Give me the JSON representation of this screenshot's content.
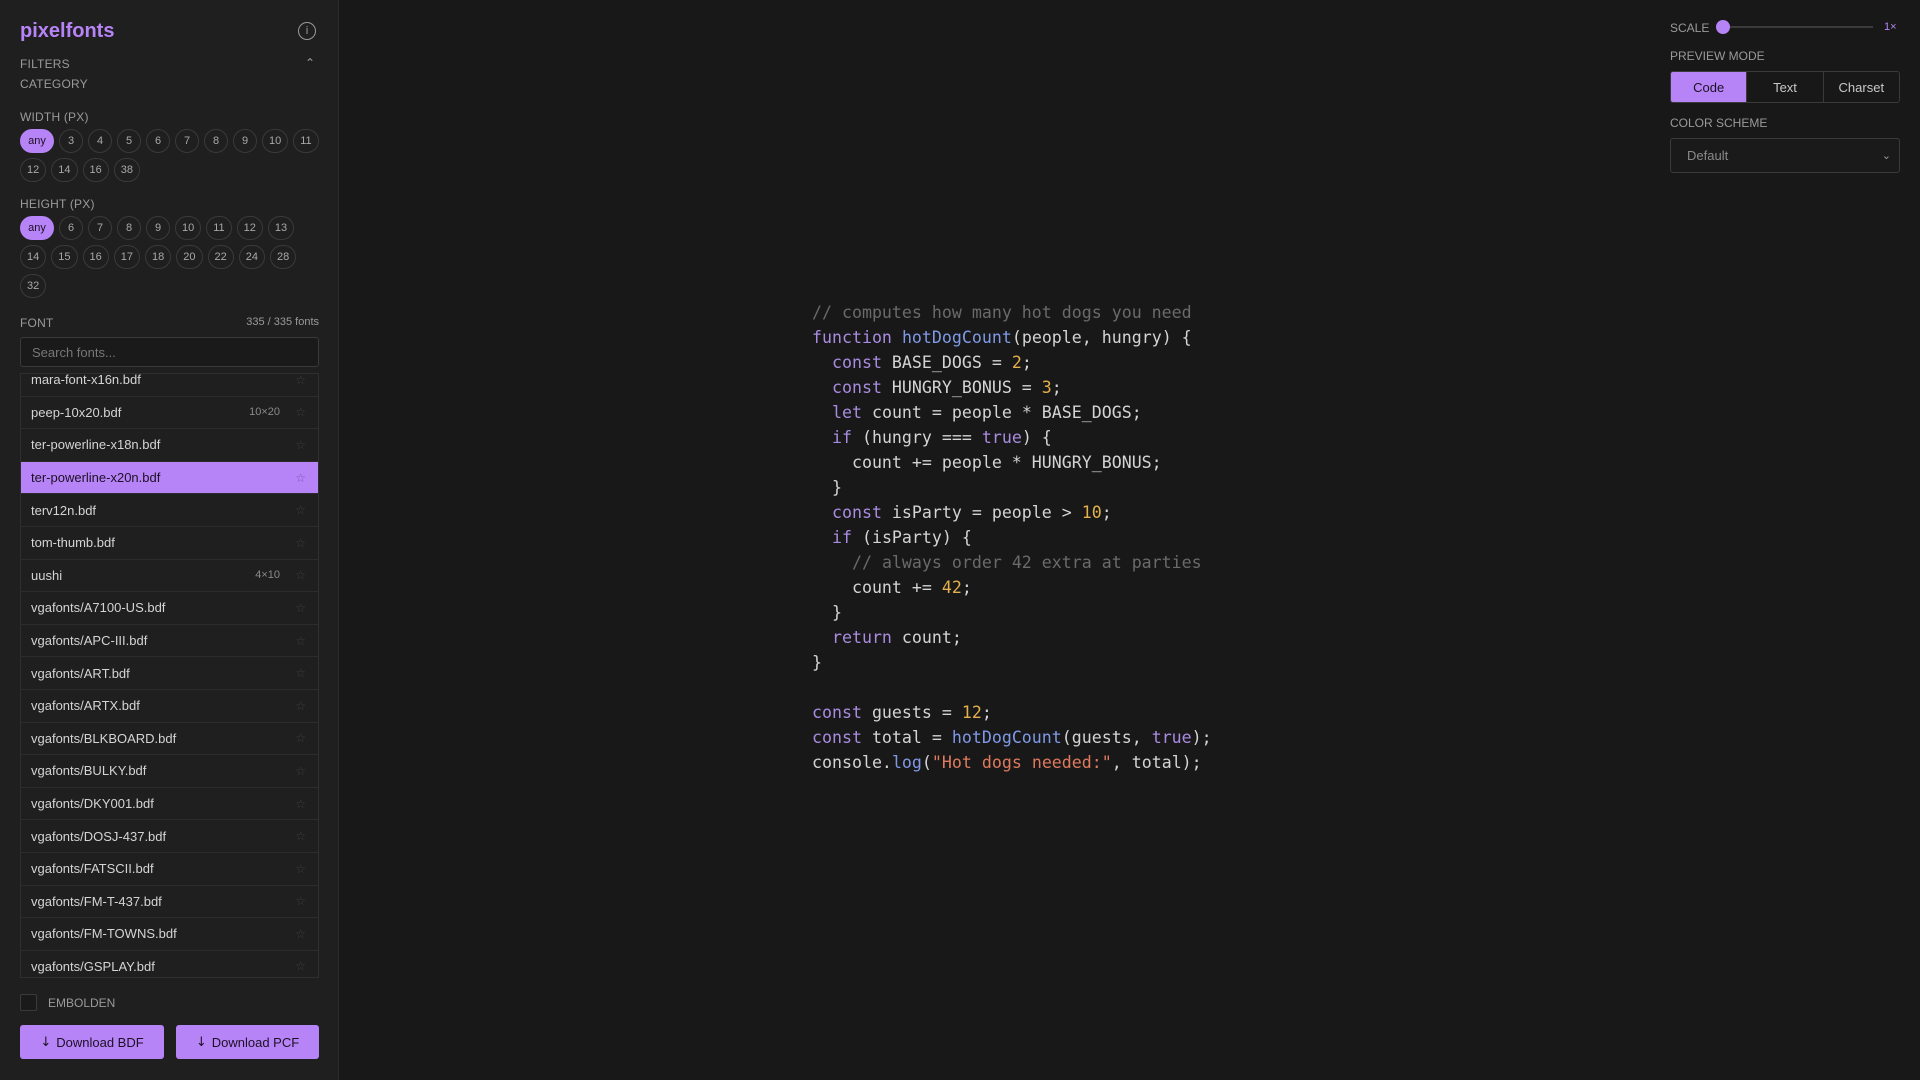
{
  "app": {
    "title": "pixelfonts"
  },
  "filters": {
    "label": "FILTERS",
    "category_label": "CATEGORY",
    "width_label": "WIDTH (PX)",
    "width_options": [
      "any",
      "3",
      "4",
      "5",
      "6",
      "7",
      "8",
      "9",
      "10",
      "11",
      "12",
      "14",
      "16",
      "38"
    ],
    "width_selected": "any",
    "height_label": "HEIGHT (PX)",
    "height_options": [
      "any",
      "6",
      "7",
      "8",
      "9",
      "10",
      "11",
      "12",
      "13",
      "14",
      "15",
      "16",
      "17",
      "18",
      "20",
      "22",
      "24",
      "28",
      "32"
    ],
    "height_selected": "any"
  },
  "font": {
    "label": "FONT",
    "count": "335 / 335 fonts",
    "search_placeholder": "Search fonts...",
    "items": [
      {
        "name": "mara-font-x16n.bdf",
        "dims": ""
      },
      {
        "name": "peep-10x20.bdf",
        "dims": "10×20"
      },
      {
        "name": "ter-powerline-x18n.bdf",
        "dims": ""
      },
      {
        "name": "ter-powerline-x20n.bdf",
        "dims": "",
        "selected": true
      },
      {
        "name": "terv12n.bdf",
        "dims": ""
      },
      {
        "name": "tom-thumb.bdf",
        "dims": ""
      },
      {
        "name": "uushi",
        "dims": "4×10"
      },
      {
        "name": "vgafonts/A7100-US.bdf",
        "dims": ""
      },
      {
        "name": "vgafonts/APC-III.bdf",
        "dims": ""
      },
      {
        "name": "vgafonts/ART.bdf",
        "dims": ""
      },
      {
        "name": "vgafonts/ARTX.bdf",
        "dims": ""
      },
      {
        "name": "vgafonts/BLKBOARD.bdf",
        "dims": ""
      },
      {
        "name": "vgafonts/BULKY.bdf",
        "dims": ""
      },
      {
        "name": "vgafonts/DKY001.bdf",
        "dims": ""
      },
      {
        "name": "vgafonts/DOSJ-437.bdf",
        "dims": ""
      },
      {
        "name": "vgafonts/FATSCII.bdf",
        "dims": ""
      },
      {
        "name": "vgafonts/FM-T-437.bdf",
        "dims": ""
      },
      {
        "name": "vgafonts/FM-TOWNS.bdf",
        "dims": ""
      },
      {
        "name": "vgafonts/GSPLAY.bdf",
        "dims": ""
      }
    ]
  },
  "embolden_label": "EMBOLDEN",
  "buttons": {
    "download_bdf": "Download BDF",
    "download_pcf": "Download PCF"
  },
  "settings": {
    "scale_label": "SCALE",
    "scale_value": "1×",
    "scale_level": 1,
    "preview_mode_label": "PREVIEW MODE",
    "preview_modes": [
      "Code",
      "Text",
      "Charset"
    ],
    "preview_mode_selected": "Code",
    "color_scheme_label": "COLOR SCHEME",
    "color_scheme_value": "Default"
  },
  "colors": {
    "accent": "#b784f7",
    "keyword": "#a98be0",
    "function": "#7f99e6",
    "number": "#e3b04b",
    "string": "#e07a5f",
    "comment": "#6a6a6a"
  },
  "code_lines": [
    [
      [
        "com",
        "// computes how many hot dogs you need"
      ]
    ],
    [
      [
        "kw",
        "function"
      ],
      [
        "",
        " "
      ],
      [
        "fn",
        "hotDogCount"
      ],
      [
        "",
        "(people, hungry) {"
      ]
    ],
    [
      [
        "",
        "  "
      ],
      [
        "kw",
        "const"
      ],
      [
        "",
        " BASE_DOGS = "
      ],
      [
        "num",
        "2"
      ],
      [
        "",
        ";"
      ]
    ],
    [
      [
        "",
        "  "
      ],
      [
        "kw",
        "const"
      ],
      [
        "",
        " HUNGRY_BONUS = "
      ],
      [
        "num",
        "3"
      ],
      [
        "",
        ";"
      ]
    ],
    [
      [
        "",
        "  "
      ],
      [
        "kw",
        "let"
      ],
      [
        "",
        " count = people * BASE_DOGS;"
      ]
    ],
    [
      [
        "",
        "  "
      ],
      [
        "kw",
        "if"
      ],
      [
        "",
        " (hungry === "
      ],
      [
        "kw",
        "true"
      ],
      [
        "",
        ") {"
      ]
    ],
    [
      [
        "",
        "    count += people * HUNGRY_BONUS;"
      ]
    ],
    [
      [
        "",
        "  }"
      ]
    ],
    [
      [
        "",
        "  "
      ],
      [
        "kw",
        "const"
      ],
      [
        "",
        " isParty = people > "
      ],
      [
        "num",
        "10"
      ],
      [
        "",
        ";"
      ]
    ],
    [
      [
        "",
        "  "
      ],
      [
        "kw",
        "if"
      ],
      [
        "",
        " (isParty) {"
      ]
    ],
    [
      [
        "",
        "    "
      ],
      [
        "com",
        "// always order 42 extra at parties"
      ]
    ],
    [
      [
        "",
        "    count += "
      ],
      [
        "num",
        "42"
      ],
      [
        "",
        ";"
      ]
    ],
    [
      [
        "",
        "  }"
      ]
    ],
    [
      [
        "",
        "  "
      ],
      [
        "kw",
        "return"
      ],
      [
        "",
        " count;"
      ]
    ],
    [
      [
        "",
        "}"
      ]
    ],
    [
      [
        "",
        ""
      ]
    ],
    [
      [
        "kw",
        "const"
      ],
      [
        "",
        " guests = "
      ],
      [
        "num",
        "12"
      ],
      [
        "",
        ";"
      ]
    ],
    [
      [
        "kw",
        "const"
      ],
      [
        "",
        " total = "
      ],
      [
        "fn",
        "hotDogCount"
      ],
      [
        "",
        "(guests, "
      ],
      [
        "kw",
        "true"
      ],
      [
        "",
        ");"
      ]
    ],
    [
      [
        "",
        "console."
      ],
      [
        "fn",
        "log"
      ],
      [
        "",
        "("
      ],
      [
        "str",
        "\"Hot dogs needed:\""
      ],
      [
        "",
        ", total);"
      ]
    ]
  ]
}
